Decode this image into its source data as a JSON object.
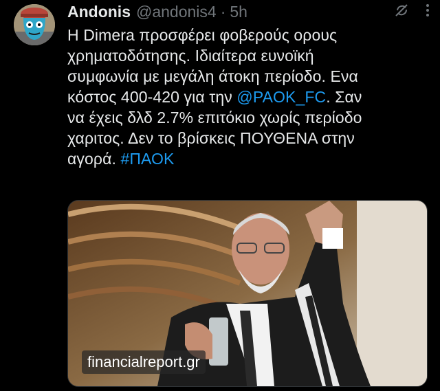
{
  "tweet": {
    "author_name": "Andonis",
    "handle": "@andonis4",
    "separator": "·",
    "time": "5h",
    "text_lines": [
      "Η Dimera προσφέρει φοβερούς ορους",
      "χρηματοδότησης. Ιδιαίτερα ευνοϊκή",
      "συμφωνία με μεγάλη άτοκη περίοδο. Ενα",
      "κόστος 400-420 για την ",
      "να έχεις δλδ 2.7% επιτόκιο χωρίς περίοδο",
      "χαριτος. Δεν το βρίσκεις ΠΟΥΘΕΝΑ στην",
      "αγορά. "
    ],
    "mention": "@PAOK_FC",
    "after_mention": ".  Σαν",
    "hashtag": "#ΠΑΟΚ",
    "image_watermark": "financialreport.gr"
  },
  "icons": {
    "avatar": "avatar-cartoon",
    "grok": "grok-icon",
    "more": "more-vertical-icon"
  },
  "colors": {
    "background": "#000000",
    "text": "#e7e9ea",
    "muted": "#71767b",
    "link": "#1d9bf0"
  }
}
